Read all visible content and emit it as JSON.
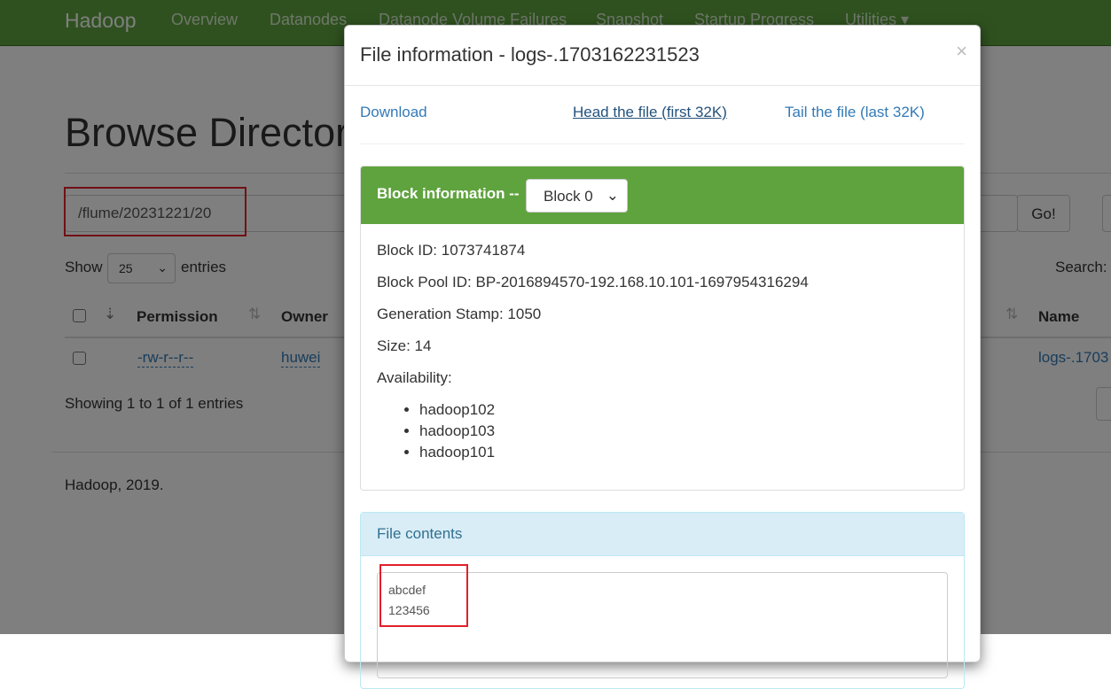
{
  "navbar": {
    "brand": "Hadoop",
    "items": [
      "Overview",
      "Datanodes",
      "Datanode Volume Failures",
      "Snapshot",
      "Startup Progress",
      "Utilities ▾"
    ]
  },
  "page": {
    "title": "Browse Directory",
    "path_value": "/flume/20231221/20",
    "go_label": "Go!",
    "show_label": "Show",
    "entries_select": "25",
    "entries_label": "entries",
    "search_label": "Search:",
    "table": {
      "headers": [
        "Permission",
        "Owner",
        "Name"
      ],
      "rows": [
        {
          "permission": "-rw-r--r--",
          "owner": "huwei",
          "name": "logs-.1703"
        }
      ]
    },
    "showing": "Showing 1 to 1 of 1 entries",
    "footer": "Hadoop, 2019."
  },
  "modal": {
    "title": "File information - logs-.1703162231523",
    "close": "×",
    "download": "Download",
    "head": "Head the file (first 32K)",
    "tail": "Tail the file (last 32K)",
    "block_heading": "Block information --",
    "block_select": "Block 0",
    "block_id": "Block ID: 1073741874",
    "block_pool": "Block Pool ID: BP-2016894570-192.168.10.101-1697954316294",
    "gen_stamp": "Generation Stamp: 1050",
    "size": "Size: 14",
    "availability": "Availability:",
    "hosts": [
      "hadoop102",
      "hadoop103",
      "hadoop101"
    ],
    "contents_heading": "File contents",
    "contents": [
      "abcdef",
      "123456"
    ]
  },
  "colors": {
    "brand": "#5fa33e",
    "highlight": "#e0202a",
    "info_bg": "#d9edf7"
  }
}
